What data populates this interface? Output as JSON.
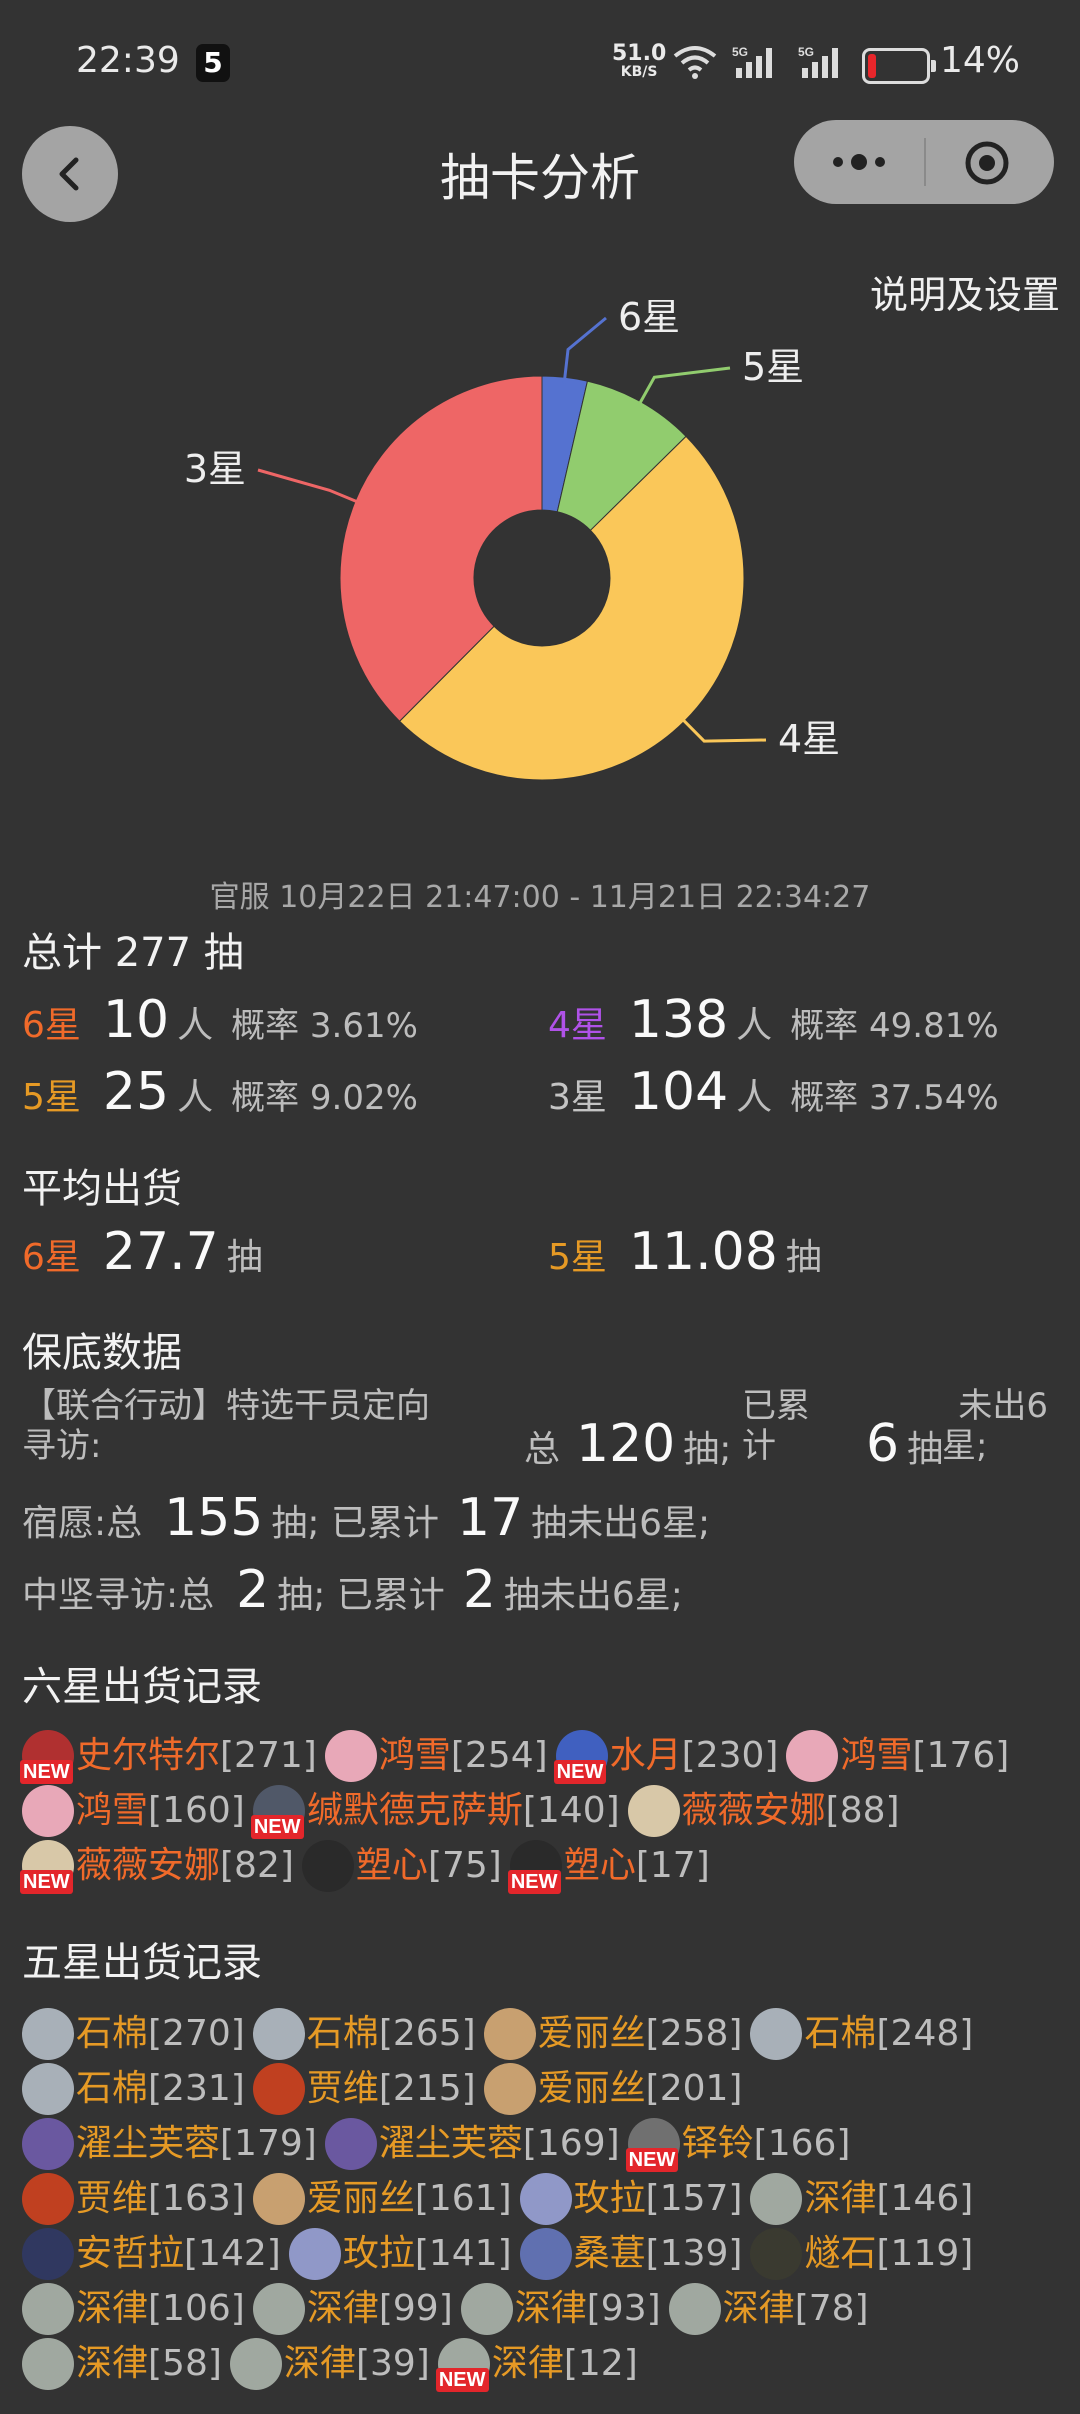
{
  "status_bar": {
    "time": "22:39",
    "sim_badge": "5",
    "net_speed": "51.0",
    "net_unit": "KB/S",
    "battery_percent": "14%",
    "battery_level": 0.14
  },
  "nav": {
    "title": "抽卡分析",
    "settings_link": "说明及设置"
  },
  "chart_data": {
    "type": "pie",
    "donut": true,
    "categories": [
      "6星",
      "5星",
      "4星",
      "3星"
    ],
    "values": [
      10,
      25,
      138,
      104
    ],
    "colors": [
      "#5572d0",
      "#91cc6e",
      "#fac759",
      "#ee6666"
    ]
  },
  "summary": {
    "date_range": "官服 10月22日 21:47:00 - 11月21日 22:34:27",
    "total": "总计 277 抽",
    "rows": [
      {
        "star": "6星",
        "count": "10",
        "unit": "人",
        "rate": "概率 3.61%"
      },
      {
        "star": "4星",
        "count": "138",
        "unit": "人",
        "rate": "概率 49.81%"
      },
      {
        "star": "5星",
        "count": "25",
        "unit": "人",
        "rate": "概率 9.02%"
      },
      {
        "star": "3星",
        "count": "104",
        "unit": "人",
        "rate": "概率 37.54%"
      }
    ]
  },
  "average": {
    "heading": "平均出货",
    "six_label": "6星",
    "six_value": "27.7",
    "six_unit": "抽",
    "five_label": "5星",
    "five_value": "11.08",
    "five_unit": "抽"
  },
  "pity": {
    "heading": "保底数据",
    "banner1_name_line1": "【联合行动】特选干员定向",
    "banner1_name_line2": "寻访:",
    "banner1_total_label": "总",
    "banner1_total": "120",
    "banner1_total_unit": "抽;",
    "banner1_acc_label_line1": "已累",
    "banner1_acc_label_line2": "计",
    "banner1_acc": "6",
    "banner1_acc_unit": "抽",
    "banner1_tail_line1": "未出6",
    "banner1_tail_line2": "星;",
    "banner2_name": "宿愿:总",
    "banner2_total": "155",
    "banner2_mid": "抽; 已累计",
    "banner2_acc": "17",
    "banner2_tail": "抽未出6星;",
    "banner3_name": "中坚寻访:总",
    "banner3_total": "2",
    "banner3_mid": "抽; 已累计",
    "banner3_acc": "2",
    "banner3_tail": "抽未出6星;"
  },
  "six_star": {
    "heading": "六星出货记录",
    "new_label": "NEW",
    "lines": [
      [
        {
          "name": "史尔特尔",
          "count": "[271]",
          "new": true,
          "color": "#b03030"
        },
        {
          "name": "鸿雪",
          "count": "[254]",
          "new": false,
          "color": "#e8a8b8"
        },
        {
          "name": "水月",
          "count": "[230]",
          "new": true,
          "color": "#4060c0"
        },
        {
          "name": "鸿雪",
          "count": "[176]",
          "new": false,
          "color": "#e8a8b8"
        }
      ],
      [
        {
          "name": "鸿雪",
          "count": "[160]",
          "new": false,
          "color": "#e8a8b8"
        },
        {
          "name": "缄默德克萨斯",
          "count": "[140]",
          "new": true,
          "color": "#505868"
        },
        {
          "name": "薇薇安娜",
          "count": "[88]",
          "new": false,
          "color": "#d8c8a8"
        }
      ],
      [
        {
          "name": "薇薇安娜",
          "count": "[82]",
          "new": true,
          "color": "#d8c8a8"
        },
        {
          "name": "塑心",
          "count": "[75]",
          "new": false,
          "color": "#2a2a2a"
        },
        {
          "name": "塑心",
          "count": "[17]",
          "new": true,
          "color": "#2a2a2a"
        }
      ]
    ]
  },
  "five_star": {
    "heading": "五星出货记录",
    "new_label": "NEW",
    "lines": [
      [
        {
          "name": "石棉",
          "count": "[270]",
          "new": false,
          "color": "#a8b0b8"
        },
        {
          "name": "石棉",
          "count": "[265]",
          "new": false,
          "color": "#a8b0b8"
        },
        {
          "name": "爱丽丝",
          "count": "[258]",
          "new": false,
          "color": "#c8a070"
        },
        {
          "name": "石棉",
          "count": "[248]",
          "new": false,
          "color": "#a8b0b8"
        }
      ],
      [
        {
          "name": "石棉",
          "count": "[231]",
          "new": false,
          "color": "#a8b0b8"
        },
        {
          "name": "贾维",
          "count": "[215]",
          "new": false,
          "color": "#c04020"
        },
        {
          "name": "爱丽丝",
          "count": "[201]",
          "new": false,
          "color": "#c8a070"
        }
      ],
      [
        {
          "name": "濯尘芙蓉",
          "count": "[179]",
          "new": false,
          "color": "#6a58a0"
        },
        {
          "name": "濯尘芙蓉",
          "count": "[169]",
          "new": false,
          "color": "#6a58a0"
        },
        {
          "name": "铎铃",
          "count": "[166]",
          "new": true,
          "color": "#707070"
        }
      ],
      [
        {
          "name": "贾维",
          "count": "[163]",
          "new": false,
          "color": "#c04020"
        },
        {
          "name": "爱丽丝",
          "count": "[161]",
          "new": false,
          "color": "#c8a070"
        },
        {
          "name": "玫拉",
          "count": "[157]",
          "new": false,
          "color": "#9098c8"
        },
        {
          "name": "深律",
          "count": "[146]",
          "new": false,
          "color": "#a0a8a0"
        }
      ],
      [
        {
          "name": "安哲拉",
          "count": "[142]",
          "new": false,
          "color": "#303860"
        },
        {
          "name": "玫拉",
          "count": "[141]",
          "new": false,
          "color": "#9098c8"
        },
        {
          "name": "桑葚",
          "count": "[139]",
          "new": false,
          "color": "#6070b0"
        },
        {
          "name": "燧石",
          "count": "[119]",
          "new": false,
          "color": "#3a3a30"
        }
      ],
      [
        {
          "name": "深律",
          "count": "[106]",
          "new": false,
          "color": "#a0a8a0"
        },
        {
          "name": "深律",
          "count": "[99]",
          "new": false,
          "color": "#a0a8a0"
        },
        {
          "name": "深律",
          "count": "[93]",
          "new": false,
          "color": "#a0a8a0"
        },
        {
          "name": "深律",
          "count": "[78]",
          "new": false,
          "color": "#a0a8a0"
        }
      ],
      [
        {
          "name": "深律",
          "count": "[58]",
          "new": false,
          "color": "#a0a8a0"
        },
        {
          "name": "深律",
          "count": "[39]",
          "new": false,
          "color": "#a0a8a0"
        },
        {
          "name": "深律",
          "count": "[12]",
          "new": true,
          "color": "#a0a8a0"
        }
      ]
    ]
  }
}
